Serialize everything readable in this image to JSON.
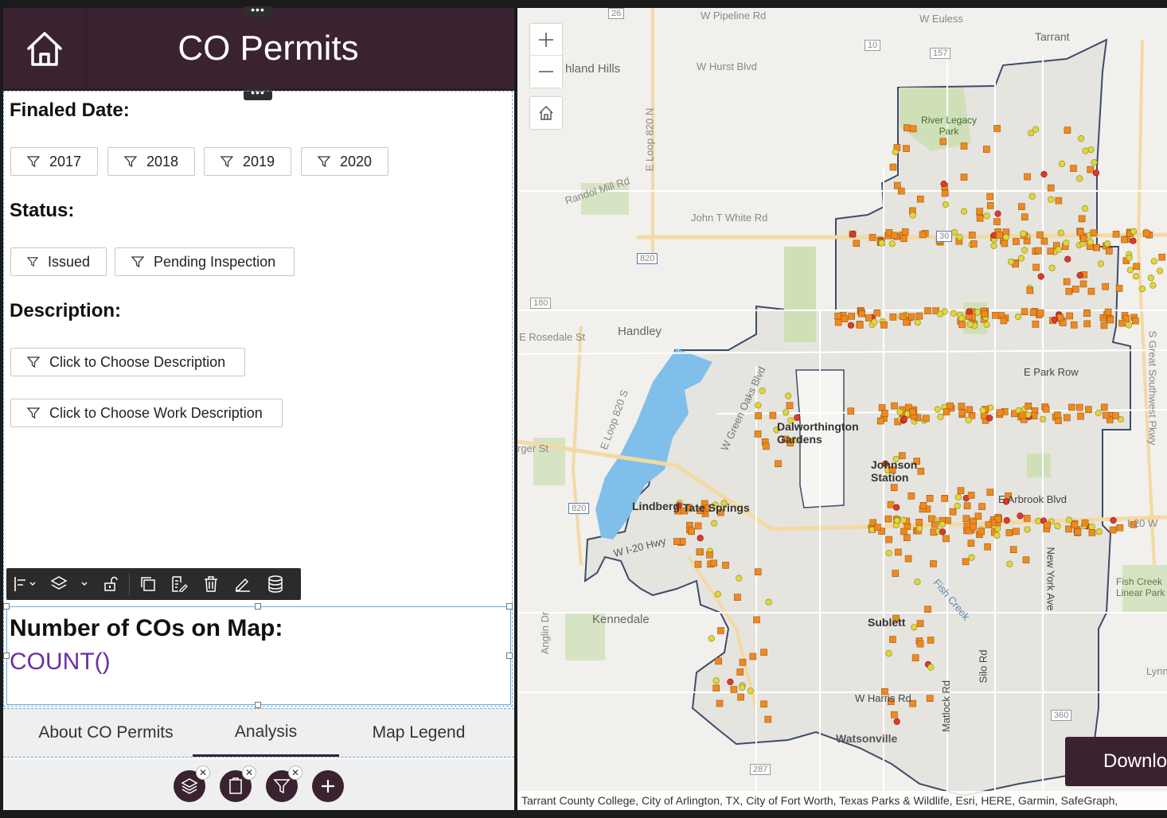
{
  "header": {
    "title": "CO Permits"
  },
  "filters": {
    "finaled_date_label": "Finaled Date:",
    "years": [
      "2017",
      "2018",
      "2019",
      "2020"
    ],
    "status_label": "Status:",
    "statuses": [
      "Issued",
      "Pending Inspection"
    ],
    "description_label": "Description:",
    "description_btn": "Click to Choose Description",
    "work_description_btn": "Click to Choose Work Description"
  },
  "count": {
    "label": "Number of COs on Map:",
    "expression": "COUNT()"
  },
  "tabs": [
    {
      "label": "About CO Permits"
    },
    {
      "label": "Analysis"
    },
    {
      "label": "Map Legend"
    }
  ],
  "map": {
    "download_label": "Downlo",
    "attribution": "Tarrant County College, City of Arlington, TX, City of Fort Worth, Texas Parks & Wildlife, Esri, HERE, Garmin, SafeGraph,",
    "labels": {
      "tarrant": "Tarrant",
      "pipeline": "W Pipeline Rd",
      "euless": "W Euless",
      "richland": "hland Hills",
      "hurst": "W Hurst Blvd",
      "river_legacy": "River Legacy Park",
      "randol": "Randol Mill Rd",
      "loop820n": "E Loop 820 N",
      "john_t_white": "John T White Rd",
      "handley": "Handley",
      "rosedale": "E Rosedale St",
      "berger": "rger St",
      "dalworthington": "Dalworthington Gardens",
      "johnson_station": "Johnson Station",
      "lindberg": "Lindberg",
      "tate_springs": "Tate Springs",
      "i20": "W I-20 Hwy",
      "i20e": "I-20 W",
      "kennedale": "Kennedale",
      "sublett": "Sublett",
      "watsonville": "Watsonville",
      "arbrook": "E Arbrook Blvd",
      "park_row": "E Park Row",
      "fish_creek": "Fish Creek Linear Park",
      "lynn": "Lynn",
      "anglin": "Anglin Dr",
      "w_harris": "W Harris Rd",
      "new_york": "New York Ave",
      "silo": "Silo Rd",
      "matlock": "Matlock Rd",
      "great_southwest": "S Great Southwest Pkwy",
      "green_oaks": "W Green Oaks Blvd",
      "loop820s": "E Loop 820 S",
      "fish_creek_road": "Fish Creek"
    },
    "shields": [
      "26",
      "10",
      "157",
      "30",
      "820",
      "180",
      "820",
      "360",
      "287"
    ]
  },
  "colors": {
    "brand": "#3a2230",
    "accent": "#6b2fa0",
    "square": "#f0891f",
    "circle": "#e0d63a",
    "red": "#e03a2a",
    "water": "#7fbfea"
  }
}
